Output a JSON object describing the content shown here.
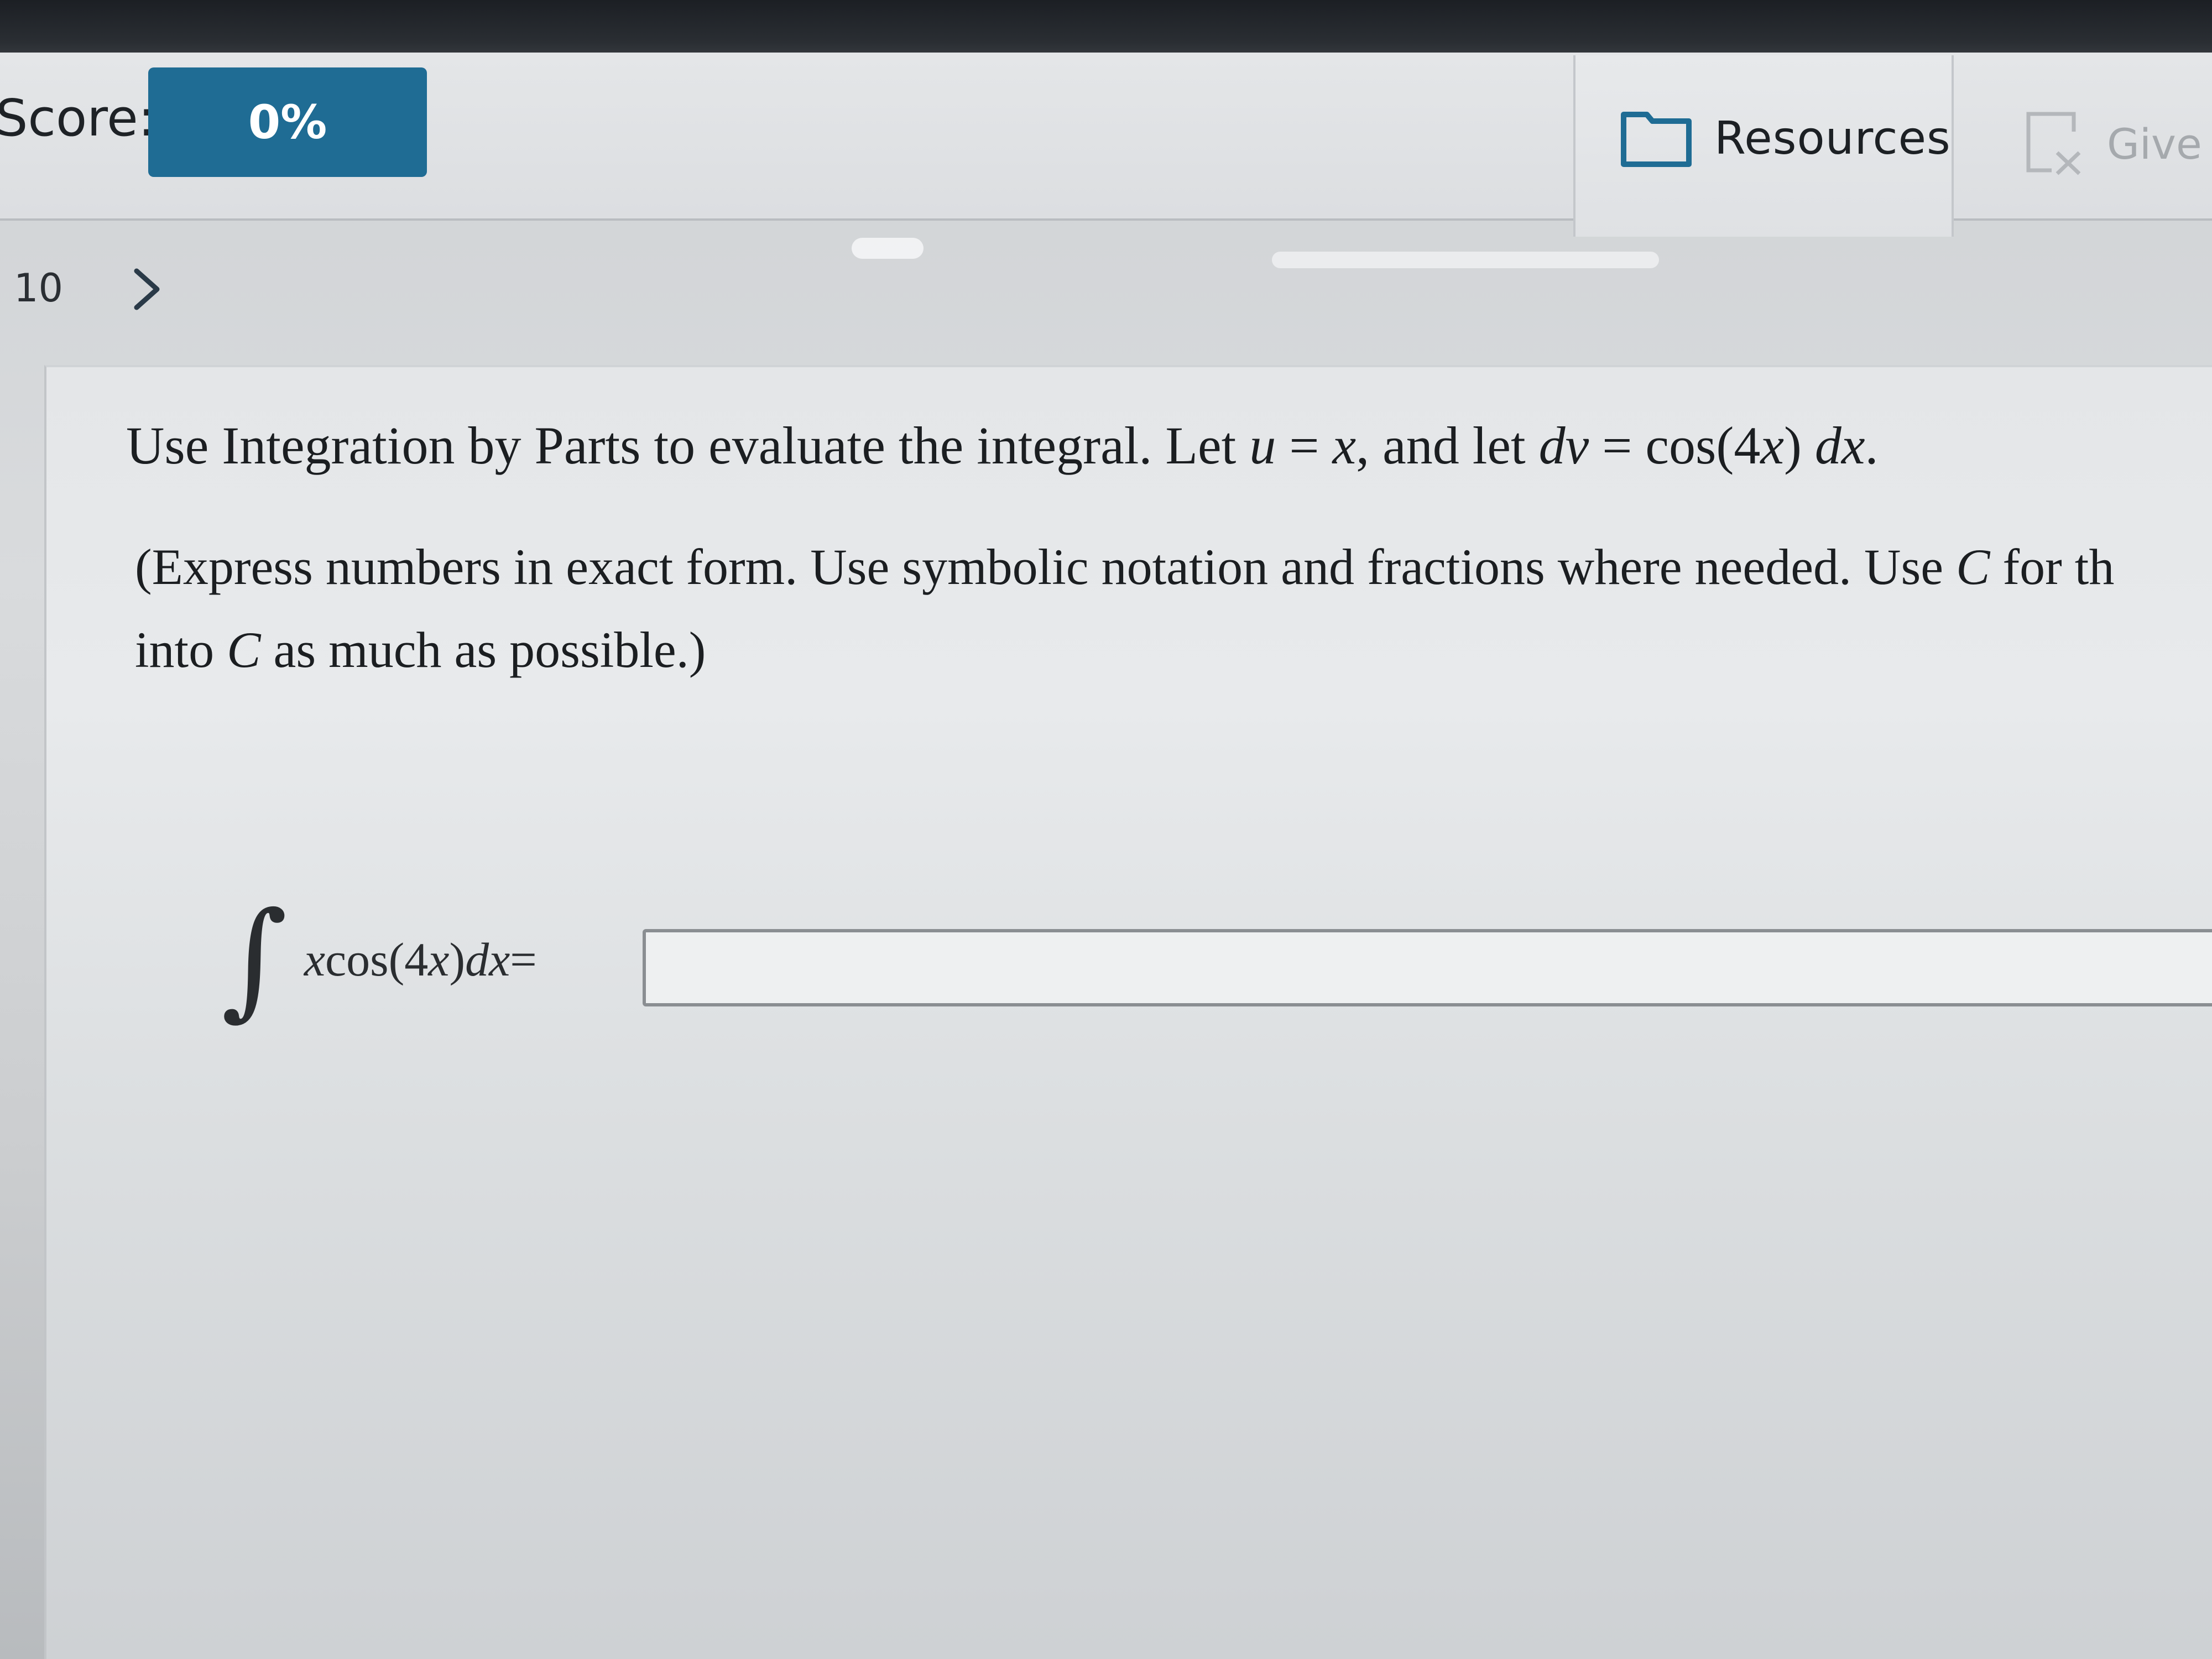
{
  "header": {
    "score_label": "Score:",
    "score_value": "0%",
    "resources_label": "Resources",
    "give_label": "Give"
  },
  "nav": {
    "question_number": "10"
  },
  "question": {
    "text_prefix": "Use Integration by Parts to evaluate the integral. Let ",
    "u": "u",
    "eq1": " = ",
    "x": "x",
    "text_mid": ", and let ",
    "dv": "dv",
    "eq2": " = ",
    "cos_expr": "cos(4",
    "x2": "x",
    "close_paren": ") ",
    "dx": "dx",
    "period": ".",
    "instructions_line1_a": "(Express numbers in exact form. Use symbolic notation and fractions where needed. Use ",
    "instructions_C": "C",
    "instructions_line1_b": " for th",
    "instructions_line2_a": "into ",
    "instructions_C2": "C",
    "instructions_line2_b": " as much as possible.)"
  },
  "integral": {
    "sign": "∫",
    "integrand_x": "x",
    "integrand_cos": " cos(4",
    "integrand_x2": "x",
    "integrand_close": ") ",
    "integrand_dx": "dx",
    "equals": " ="
  },
  "answer": {
    "value": ""
  },
  "icons": {
    "resources": "folder-icon",
    "give": "give-up-icon",
    "next": "chevron-right-icon"
  }
}
